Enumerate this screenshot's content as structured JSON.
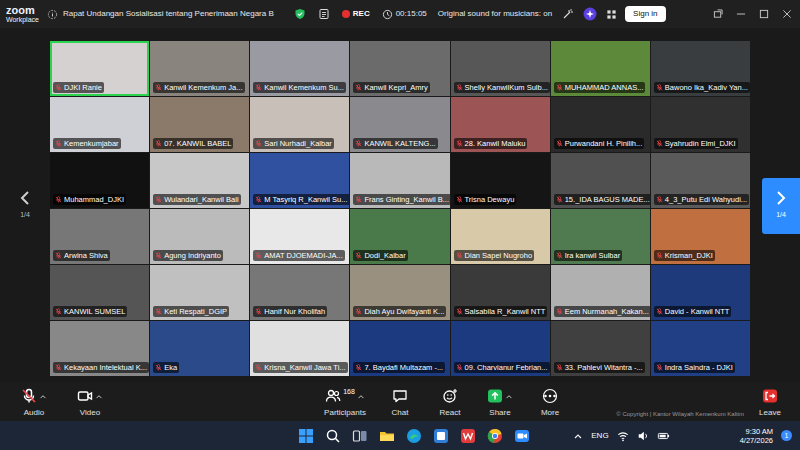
{
  "window": {
    "logo": "zoom",
    "product": "Workplace",
    "title": "Rapat Undangan Sosialisasi tentang Penerimaan Negara B",
    "recording": "REC",
    "timer": "00:15:05",
    "audio_mode": "Original sound for musicians: on",
    "sign_in": "Sign in"
  },
  "gallery": {
    "page_left": "1/4",
    "page_right": "1/4",
    "tiles": [
      {
        "name": "DJKI Ranie",
        "muted": true,
        "speaking": true
      },
      {
        "name": "Kanwil Kemenkum Ja...",
        "muted": true,
        "speaking": false
      },
      {
        "name": "Kanwil Kemenkum Su...",
        "muted": true,
        "speaking": false
      },
      {
        "name": "Kanwil Kepri_Amry",
        "muted": true,
        "speaking": false
      },
      {
        "name": "Shelly KanwilKum Sulb...",
        "muted": true,
        "speaking": false
      },
      {
        "name": "MUHAMMAD ANNAS...",
        "muted": true,
        "speaking": false
      },
      {
        "name": "Bawono Ika_Kadiv Yan...",
        "muted": true,
        "speaking": false
      },
      {
        "name": "Kemenkumjabar",
        "muted": true,
        "speaking": false
      },
      {
        "name": "07. KANWIL BABEL",
        "muted": true,
        "speaking": false
      },
      {
        "name": "Sari Nurhadi_Kalbar",
        "muted": true,
        "speaking": false
      },
      {
        "name": "KANWIL KALTENG...",
        "muted": true,
        "speaking": false
      },
      {
        "name": "28. Kanwil Maluku",
        "muted": true,
        "speaking": false
      },
      {
        "name": "Purwandani H. Pinilih...",
        "muted": true,
        "speaking": false
      },
      {
        "name": "Syahrudin Elmi_DJKI",
        "muted": true,
        "speaking": false
      },
      {
        "name": "Muhammad_DJKI",
        "muted": true,
        "speaking": false
      },
      {
        "name": "Wulandari_Kanwil Bali",
        "muted": true,
        "speaking": false
      },
      {
        "name": "M Tasyriq R_Kanwil Su...",
        "muted": true,
        "speaking": false
      },
      {
        "name": "Frans Ginting_Kanwil B...",
        "muted": true,
        "speaking": false
      },
      {
        "name": "Trisna Dewayu",
        "muted": true,
        "speaking": false
      },
      {
        "name": "15._IDA BAGUS MADE...",
        "muted": true,
        "speaking": false
      },
      {
        "name": "4_3_Putu Edi Wahyudi...",
        "muted": true,
        "speaking": false
      },
      {
        "name": "Arwina Shiva",
        "muted": true,
        "speaking": false
      },
      {
        "name": "Agung Indriyanto",
        "muted": true,
        "speaking": false
      },
      {
        "name": "AMAT DJOEMADI-JA...",
        "muted": true,
        "speaking": false
      },
      {
        "name": "Dodi_Kalbar",
        "muted": true,
        "speaking": false
      },
      {
        "name": "Dian Sapei Nugroho",
        "muted": true,
        "speaking": false
      },
      {
        "name": "Ira kanwil Sulbar",
        "muted": true,
        "speaking": false
      },
      {
        "name": "Krisman_DJKI",
        "muted": true,
        "speaking": false
      },
      {
        "name": "KANWIL SUMSEL",
        "muted": true,
        "speaking": false
      },
      {
        "name": "Keti Respati_DGIP",
        "muted": true,
        "speaking": false
      },
      {
        "name": "Hanif Nur Kholifah",
        "muted": true,
        "speaking": false
      },
      {
        "name": "Diah Ayu Dwifayanti K...",
        "muted": true,
        "speaking": false
      },
      {
        "name": "Salsabila R_Kanwil NTT",
        "muted": true,
        "speaking": false
      },
      {
        "name": "Eem Nurmanah_Kakan...",
        "muted": true,
        "speaking": false
      },
      {
        "name": "David - Kanwil NTT",
        "muted": true,
        "speaking": false
      },
      {
        "name": "Kekayaan Intelektual K...",
        "muted": true,
        "speaking": false
      },
      {
        "name": "Eka",
        "muted": true,
        "speaking": false
      },
      {
        "name": "Krisna_Kanwil Jawa Ti...",
        "muted": true,
        "speaking": false
      },
      {
        "name": "7. Baydafi Multazam -...",
        "muted": true,
        "speaking": false
      },
      {
        "name": "09. Charvianur Febrian...",
        "muted": true,
        "speaking": false
      },
      {
        "name": "33. Pahlevi Witantra -...",
        "muted": true,
        "speaking": false
      },
      {
        "name": "Indra Saindra - DJKI",
        "muted": true,
        "speaking": false
      }
    ]
  },
  "toolbar": {
    "items": [
      {
        "label": "Audio",
        "kind": "audio",
        "muted": true,
        "has_menu": true
      },
      {
        "label": "Video",
        "kind": "video",
        "has_menu": true
      },
      {
        "label": "Participants",
        "kind": "participants",
        "badge": "168",
        "has_menu": true
      },
      {
        "label": "Chat",
        "kind": "chat",
        "has_menu": false
      },
      {
        "label": "React",
        "kind": "react",
        "has_menu": false
      },
      {
        "label": "Share",
        "kind": "share",
        "has_menu": true
      },
      {
        "label": "More",
        "kind": "more",
        "has_menu": false
      },
      {
        "label": "Leave",
        "kind": "leave",
        "has_menu": false
      }
    ],
    "copyright": "© Copyright | Kantor Wilayah Kemenkum Kaltim"
  },
  "taskbar": {
    "language": "ENG",
    "time": "9:30 AM",
    "date": "4/27/2026",
    "notifications": "1"
  }
}
